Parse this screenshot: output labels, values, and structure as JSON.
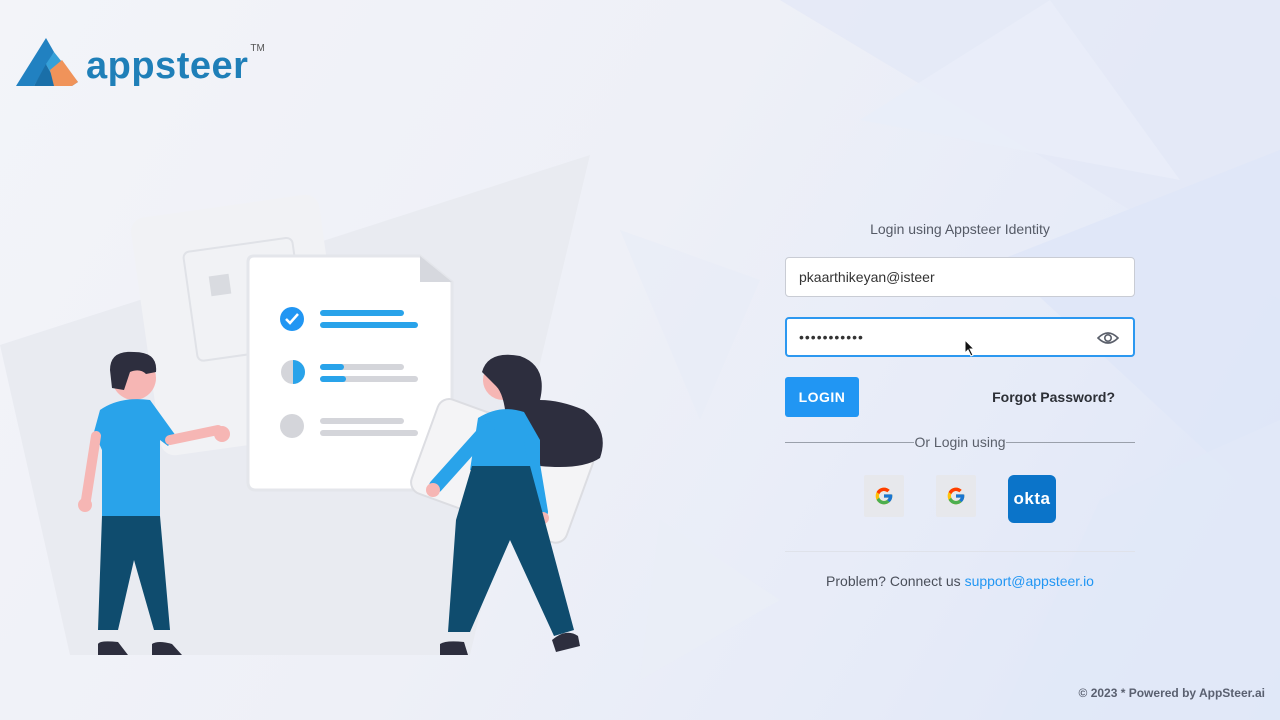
{
  "brand": {
    "name": "appsteer",
    "trademark": "TM"
  },
  "login": {
    "title": "Login using Appsteer Identity",
    "email_value": "pkaarthikeyan@isteer",
    "password_value": "•••••••••••",
    "login_button": "LOGIN",
    "forgot_password": "Forgot Password?",
    "or_login_using": "Or Login using",
    "sso_providers": [
      "google",
      "google",
      "okta"
    ],
    "okta_label": "okta"
  },
  "support": {
    "text": "Problem? Connect us",
    "email": "support@appsteer.io"
  },
  "footer": {
    "text": "© 2023 * Powered by AppSteer.ai"
  },
  "colors": {
    "primary": "#2196f3",
    "brand": "#1f7fb8",
    "okta": "#0b74c9"
  }
}
